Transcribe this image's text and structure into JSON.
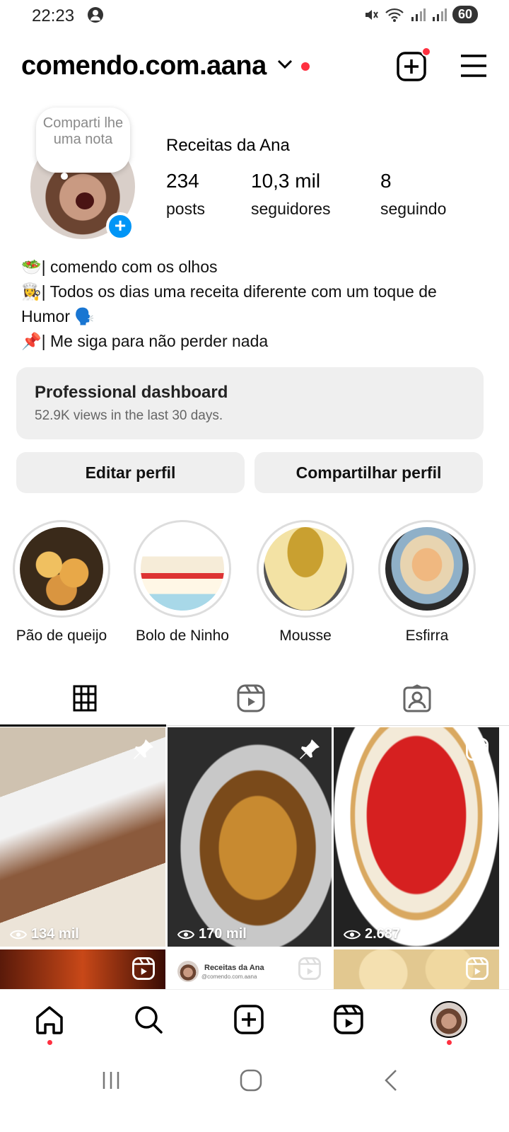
{
  "status_bar": {
    "time": "22:23",
    "battery": "60"
  },
  "header": {
    "username": "comendo.com.aana"
  },
  "profile": {
    "note": "Comparti lhe uma nota",
    "display_name": "Receitas da Ana",
    "posts_count": "234",
    "posts_label": "posts",
    "followers_count": "10,3 mil",
    "followers_label": "seguidores",
    "following_count": "8",
    "following_label": "seguindo"
  },
  "bio": [
    "🥗| comendo com os olhos",
    "👩‍🍳| Todos os dias uma receita diferente com um toque de Humor 🗣️",
    "📌| Me siga para não perder nada"
  ],
  "dashboard": {
    "title": "Professional dashboard",
    "subtitle": "52.9K views in the last 30 days."
  },
  "buttons": {
    "edit": "Editar perfil",
    "share": "Compartilhar perfil"
  },
  "highlights": [
    {
      "label": "Pão de queijo"
    },
    {
      "label": "Bolo de Ninho"
    },
    {
      "label": "Mousse"
    },
    {
      "label": "Esfirra"
    }
  ],
  "grid": {
    "row1": [
      {
        "views": "134 mil",
        "badge": "pin-icon"
      },
      {
        "views": "170 mil",
        "badge": "pin-icon"
      },
      {
        "views": "2.687",
        "badge": "reels-icon"
      }
    ],
    "row2_card": {
      "name": "Receitas da Ana",
      "handle": "@comendo.com.aana"
    }
  },
  "colors": {
    "accent_red": "#ff3040",
    "blue": "#0095f6",
    "button_bg": "#efefef"
  }
}
